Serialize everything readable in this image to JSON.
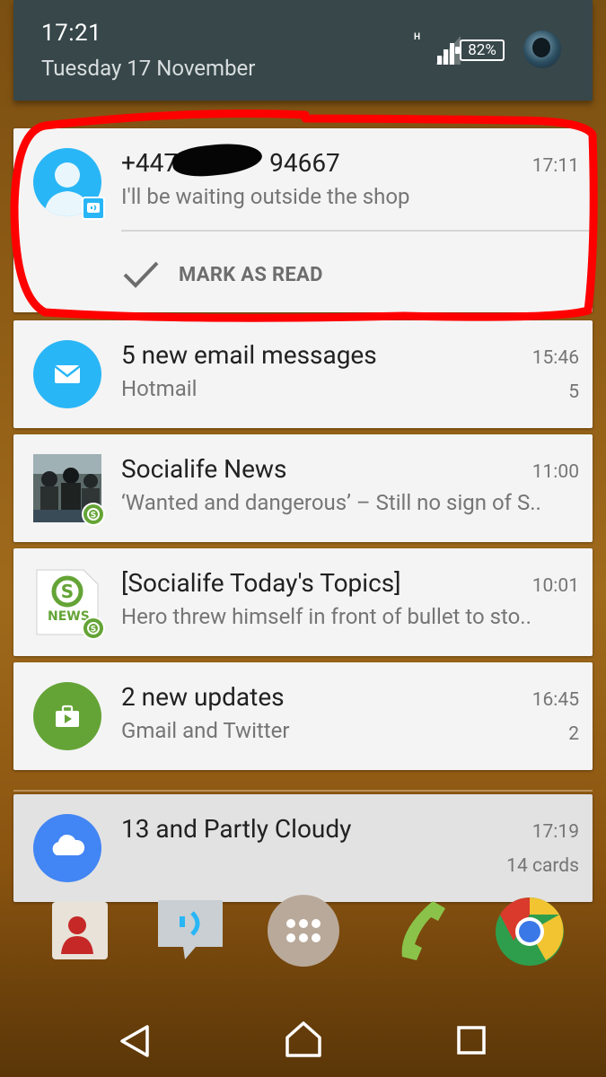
{
  "status": {
    "time": "17:21",
    "date": "Tuesday 17 November",
    "network_type": "H",
    "battery": "82%"
  },
  "notifications": [
    {
      "icon": "contact-avatar-icon",
      "badge_icon": "messaging-badge-icon",
      "title": "+447",
      "title_tail": "94667",
      "subtitle": "I'll be waiting outside the shop",
      "time": "17:11",
      "action": "MARK AS READ"
    },
    {
      "icon": "email-icon",
      "title": "5 new email messages",
      "subtitle": "Hotmail",
      "time": "15:46",
      "count": "5"
    },
    {
      "icon": "news-photo-icon",
      "badge_icon": "socialife-badge-icon",
      "title": "Socialife News",
      "subtitle": "‘Wanted and dangerous’ – Still no sign of S..",
      "time": "11:00"
    },
    {
      "icon": "socialife-news-icon",
      "badge_icon": "socialife-badge-icon",
      "icon_text": "NEWS",
      "title": "[Socialife Today's Topics]",
      "subtitle": "Hero threw himself in front of bullet to sto..",
      "time": "10:01"
    },
    {
      "icon": "updates-icon",
      "title": "2 new updates",
      "subtitle": "Gmail and Twitter",
      "time": "16:45",
      "count": "2"
    },
    {
      "icon": "weather-cloud-icon",
      "title": "13 and Partly Cloudy",
      "time": "17:19",
      "count": "14 cards"
    }
  ],
  "dock": [
    "contacts-icon",
    "messaging-icon",
    "apps-drawer-icon",
    "phone-icon",
    "chrome-icon"
  ],
  "nav": [
    "back-icon",
    "home-icon",
    "recents-icon"
  ],
  "colors": {
    "status_bg": "#37474a",
    "card_bg": "#f4f4f4",
    "email_blue": "#29b6f6",
    "updates_green": "#64a436",
    "weather_blue": "#4285f4",
    "annotation_red": "#ff0000"
  }
}
